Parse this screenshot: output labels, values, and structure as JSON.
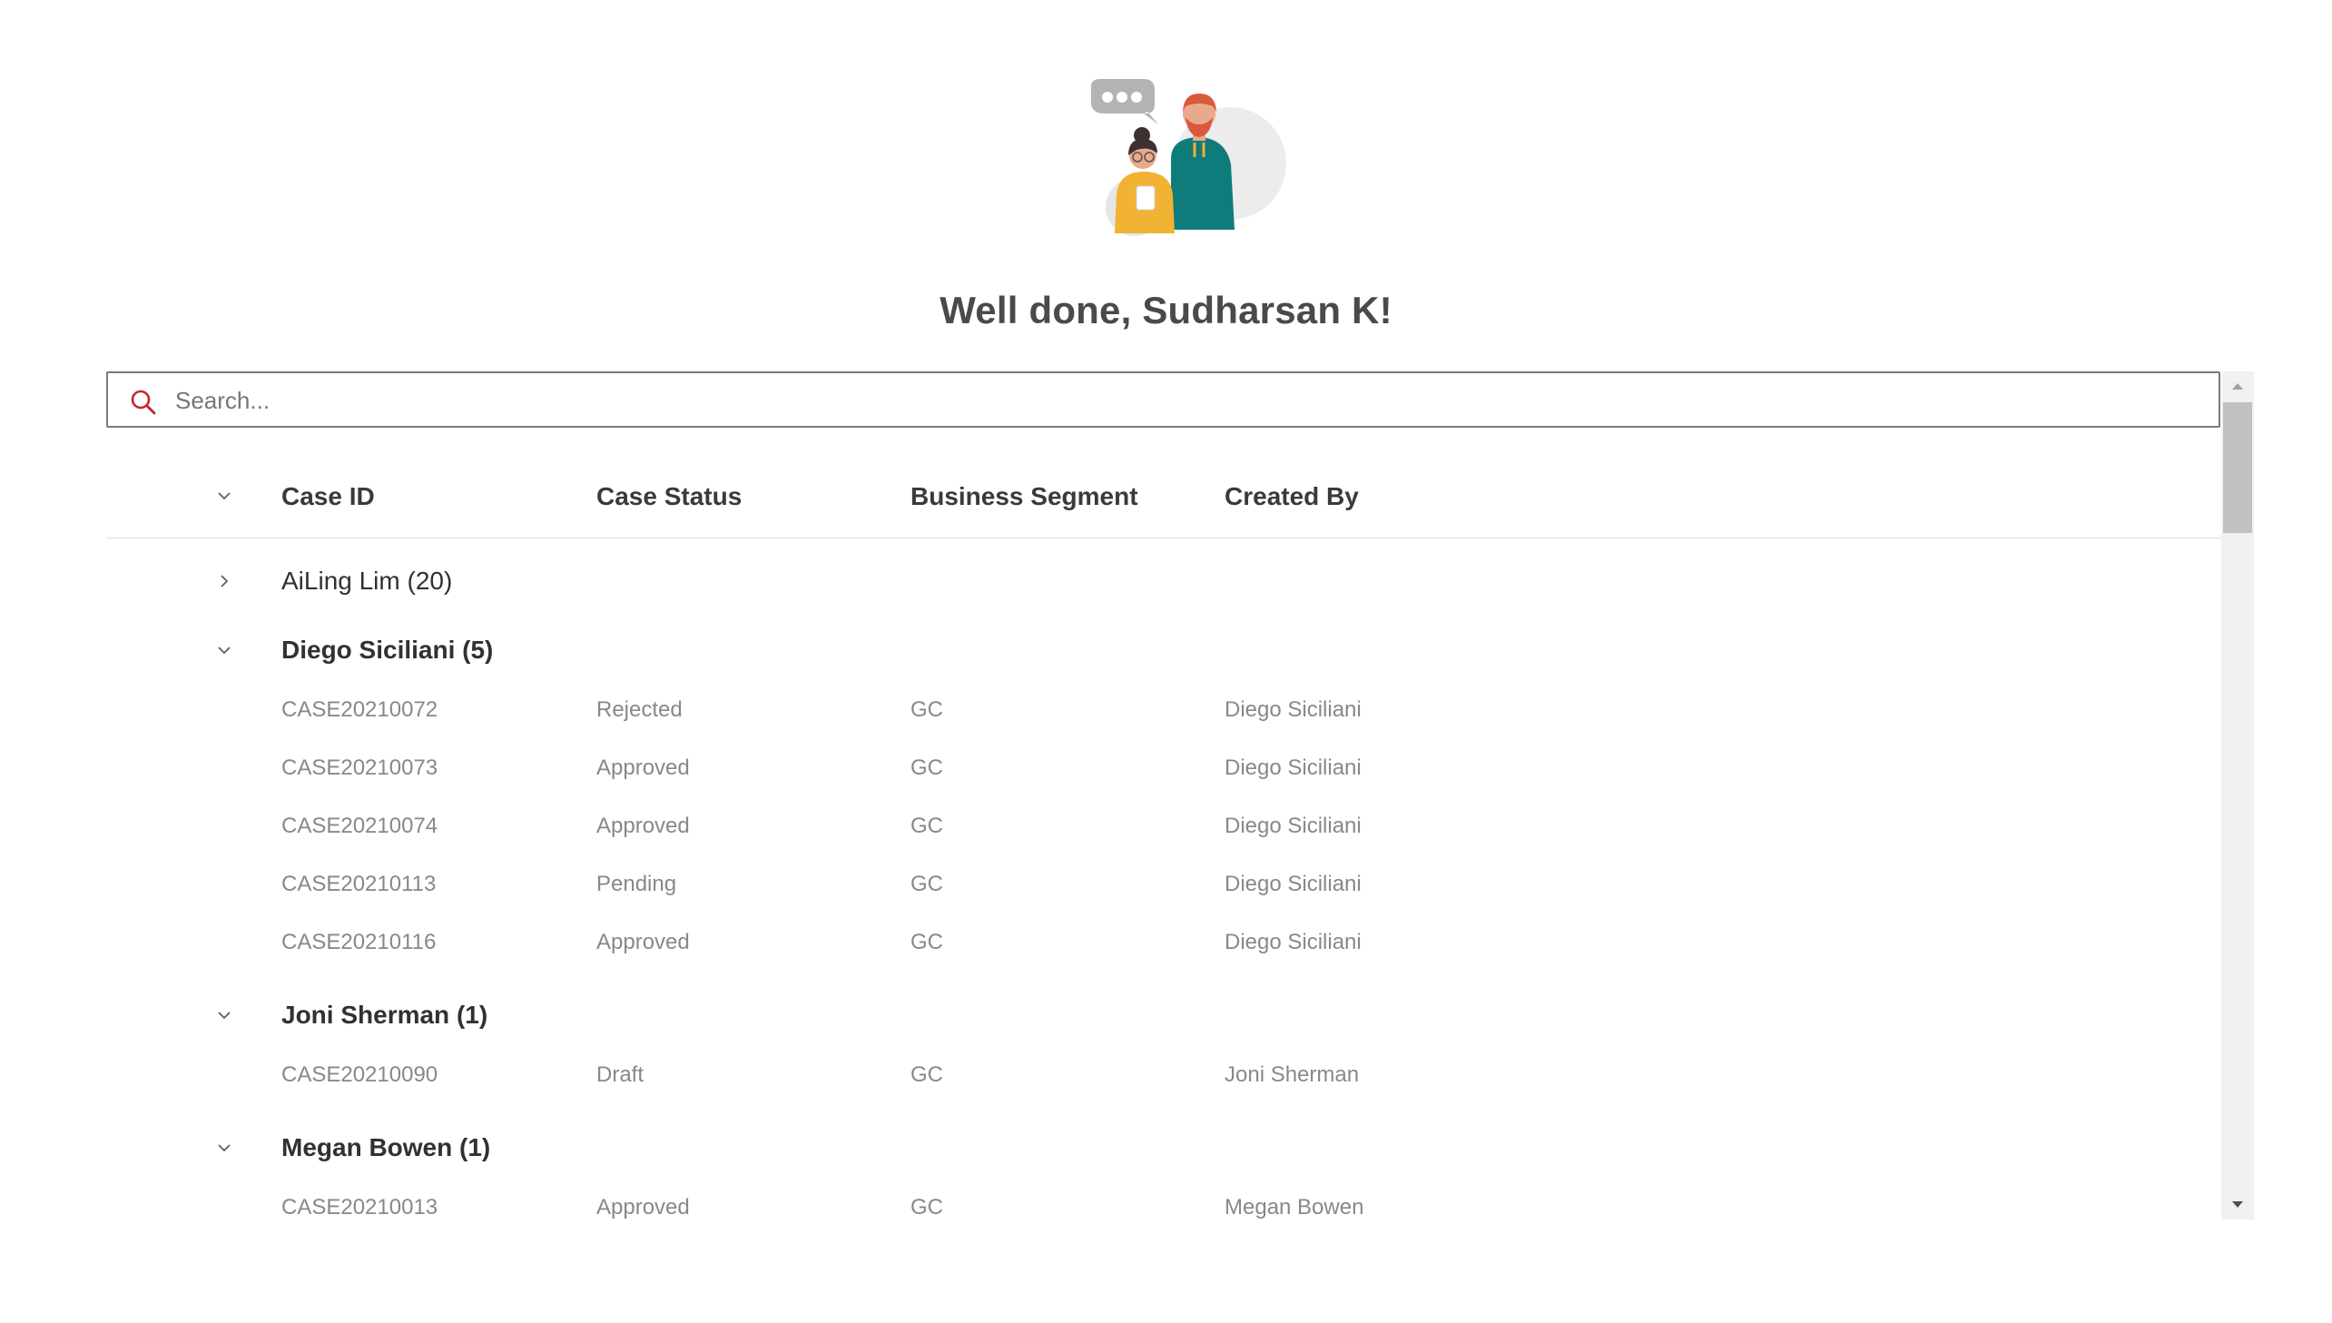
{
  "hero": {
    "welcome_text": "Well done, Sudharsan K!"
  },
  "search": {
    "placeholder": "Search..."
  },
  "grid": {
    "columns": [
      "Case ID",
      "Case Status",
      "Business Segment",
      "Created By"
    ],
    "groups": [
      {
        "label": "AiLing Lim (20)",
        "expanded": false,
        "rows": []
      },
      {
        "label": "Diego Siciliani (5)",
        "expanded": true,
        "rows": [
          [
            "CASE20210072",
            "Rejected",
            "GC",
            "Diego Siciliani"
          ],
          [
            "CASE20210073",
            "Approved",
            "GC",
            "Diego Siciliani"
          ],
          [
            "CASE20210074",
            "Approved",
            "GC",
            "Diego Siciliani"
          ],
          [
            "CASE20210113",
            "Pending",
            "GC",
            "Diego Siciliani"
          ],
          [
            "CASE20210116",
            "Approved",
            "GC",
            "Diego Siciliani"
          ]
        ]
      },
      {
        "label": "Joni Sherman (1)",
        "expanded": true,
        "rows": [
          [
            "CASE20210090",
            "Draft",
            "GC",
            "Joni Sherman"
          ]
        ]
      },
      {
        "label": "Megan Bowen (1)",
        "expanded": true,
        "rows": [
          [
            "CASE20210013",
            "Approved",
            "GC",
            "Megan Bowen"
          ]
        ]
      }
    ]
  },
  "colors": {
    "search_icon": "#c4262e",
    "teal": "#0f7c7c",
    "yellow": "#f2b233",
    "hair_red": "#d85a3a"
  }
}
